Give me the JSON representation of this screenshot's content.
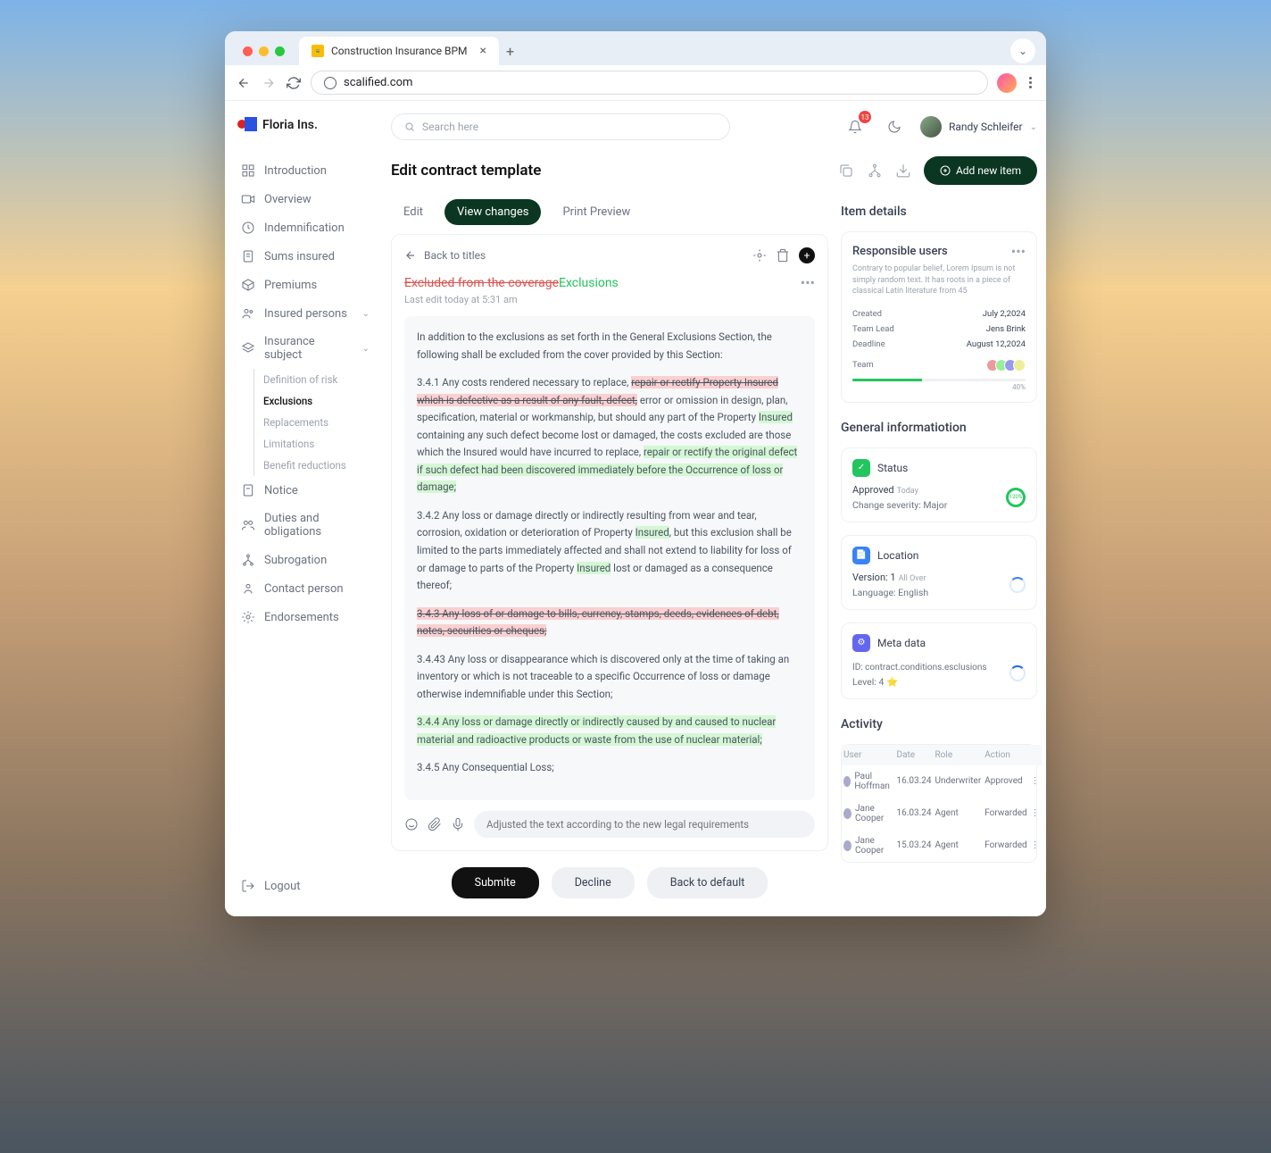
{
  "browser": {
    "tab_title": "Construction Insurance BPM",
    "url": "scalified.com"
  },
  "brand": {
    "name": "Floria Ins."
  },
  "search_placeholder": "Search here",
  "notification_count": "13",
  "user_name": "Randy Schleifer",
  "sidebar": {
    "items": [
      {
        "label": "Introduction"
      },
      {
        "label": "Overview"
      },
      {
        "label": "Indemnification"
      },
      {
        "label": "Sums insured"
      },
      {
        "label": "Premiums"
      },
      {
        "label": "Insured persons"
      },
      {
        "label": "Insurance subject"
      },
      {
        "label": "Notice"
      },
      {
        "label": "Duties and obligations"
      },
      {
        "label": "Subrogation"
      },
      {
        "label": "Contact person"
      },
      {
        "label": "Endorsements"
      }
    ],
    "sub_items": [
      {
        "label": "Definition of risk"
      },
      {
        "label": "Exclusions"
      },
      {
        "label": "Replacements"
      },
      {
        "label": "Limitations"
      },
      {
        "label": "Benefit reductions"
      }
    ],
    "logout": "Logout"
  },
  "page": {
    "title": "Edit contract template",
    "add_btn": "Add new item",
    "tabs": [
      "Edit",
      "View changes",
      "Print Preview"
    ],
    "back": "Back to titles"
  },
  "doc": {
    "title_old": "Excluded from the coverage",
    "title_new": "Exclusions",
    "subtitle": "Last edit today at 5:31 am",
    "intro": "In addition to the exclusions as set forth in the General Exclusions Section, the following shall be excluded from the cover provided by this Section:",
    "p341_a": "3.4.1  Any costs rendered necessary to replace, ",
    "p341_del1": "repair or rectify Property Insured which is defective as a result of any fault, defect,",
    "p341_b": " error or omission in design, plan, specification, material or workmanship, but should any part of the Property ",
    "p341_ins1": "Insured",
    "p341_c": " containing any such defect become lost or damaged, the costs excluded are those which the Insured would have incurred to replace, ",
    "p341_ins2": "repair or rectify the original defect if such defect had been discovered immediately before the Occurrence of loss or damage;",
    "p342_a": "3.4.2  Any loss or damage directly or indirectly resulting from wear and tear, corrosion, oxidation or deterioration of Property ",
    "p342_ins": "Insured",
    "p342_b": ", but this exclusion shall be limited to the parts immediately affected and shall not extend to liability for loss of or damage to parts of the Property ",
    "p342_ins2": "Insured",
    "p342_c": " lost or damaged as a consequence thereof;",
    "p343": "3.4.3  Any loss of or damage to bills, currency, stamps, deeds, evidences of debt, notes, securities or cheques;",
    "p3443": "3.4.43  Any loss or disappearance which is discovered only at the time of taking an inventory or which is not traceable to a specific Occurrence of loss or damage otherwise indemnifiable under this Section;",
    "p344": "3.4.4 Any loss or damage directly or indirectly caused by and caused to nuclear material and radioactive products or waste from the use of nuclear material;",
    "p345": "3.4.5 Any Consequential Loss;",
    "comment_placeholder": "Adjusted the text according to the new legal requirements"
  },
  "actions": {
    "submit": "Submite",
    "decline": "Decline",
    "reset": "Back to default"
  },
  "details": {
    "heading": "Item details",
    "responsible": {
      "title": "Responsible users",
      "desc": "Contrary to popular belief, Lorem Ipsum is not simply random text. It has roots in a piece of classical Latin literature from 45",
      "rows": [
        {
          "k": "Created",
          "v": "July 2,2024"
        },
        {
          "k": "Team Lead",
          "v": "Jens Brink"
        },
        {
          "k": "Deadline",
          "v": "August 12,2024"
        }
      ],
      "team_label": "Team",
      "progress_pct": "40%"
    },
    "general_heading": "General informatiotion",
    "status": {
      "label": "Status",
      "value": "Approved",
      "when": "Today",
      "severity": "Change severity: Major",
      "ring": "120%"
    },
    "location": {
      "label": "Location",
      "version_label": "Version: 1",
      "version_sub": "All Over",
      "lang": "Language: English"
    },
    "meta": {
      "label": "Meta data",
      "id": "ID: contract.conditions.esclusions",
      "level": "Level: 4"
    },
    "activity_heading": "Activity",
    "activity_headers": [
      "User",
      "Date",
      "Role",
      "Action"
    ],
    "activity": [
      {
        "user": "Paul Hoffman",
        "date": "16.03.24",
        "role": "Underwriter",
        "action": "Approved",
        "cls": "approved"
      },
      {
        "user": "Jane Cooper",
        "date": "16.03.24",
        "role": "Agent",
        "action": "Forwarded",
        "cls": "forwarded"
      },
      {
        "user": "Jane Cooper",
        "date": "15.03.24",
        "role": "Agent",
        "action": "Forwarded",
        "cls": "forwarded"
      }
    ]
  }
}
